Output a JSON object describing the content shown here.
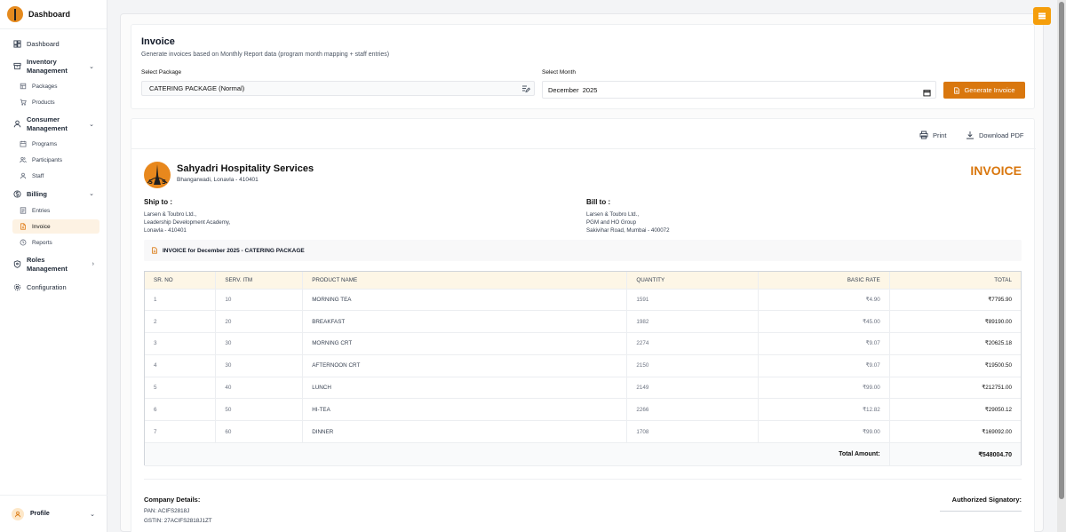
{
  "app": {
    "title": "Dashboard"
  },
  "sidebar": {
    "dashboard": "Dashboard",
    "inventory": {
      "label": "Inventory Management",
      "items": [
        "Packages",
        "Products"
      ]
    },
    "consumer": {
      "label": "Consumer Management",
      "items": [
        "Programs",
        "Participants",
        "Staff"
      ]
    },
    "billing": {
      "label": "Billing",
      "items": [
        "Entries",
        "Invoice",
        "Reports"
      ]
    },
    "roles": "Roles Management",
    "configuration": "Configuration",
    "profile": "Profile"
  },
  "page": {
    "title": "Invoice",
    "subtitle": "Generate invoices based on Monthly Report data (program month mapping + staff entries)",
    "package_label": "Select Package",
    "package_value": "CATERING PACKAGE (Normal)",
    "month_label": "Select Month",
    "month_value": "December  2025",
    "generate_label": "Generate Invoice"
  },
  "toolbar": {
    "print": "Print",
    "download": "Download PDF"
  },
  "invoice": {
    "company_name": "Sahyadri Hospitality Services",
    "company_address": "Bhangarwadi, Lonavla - 410401",
    "heading": "INVOICE",
    "ship_to": {
      "title": "Ship to :",
      "lines": [
        "Larsen & Toubro Ltd.,",
        "Leadership Development Academy,",
        "Lonavla - 410401"
      ]
    },
    "bill_to": {
      "title": "Bill to :",
      "lines": [
        "Larsen & Toubro Ltd.,",
        "PGM and HO Group",
        "Sakivihar Road, Mumbai - 400072"
      ]
    },
    "strip": "INVOICE for December 2025 - CATERING PACKAGE",
    "columns": [
      "SR. NO",
      "SERV. ITM",
      "PRODUCT NAME",
      "QUANTITY",
      "BASIC RATE",
      "TOTAL"
    ],
    "rows": [
      [
        "1",
        "10",
        "MORNING TEA",
        "1591",
        "₹4.90",
        "₹7795.90"
      ],
      [
        "2",
        "20",
        "BREAKFAST",
        "1982",
        "₹45.00",
        "₹89190.00"
      ],
      [
        "3",
        "30",
        "MORNING CRT",
        "2274",
        "₹9.07",
        "₹20625.18"
      ],
      [
        "4",
        "30",
        "AFTERNOON CRT",
        "2150",
        "₹9.07",
        "₹19500.50"
      ],
      [
        "5",
        "40",
        "LUNCH",
        "2149",
        "₹99.00",
        "₹212751.00"
      ],
      [
        "6",
        "50",
        "HI-TEA",
        "2266",
        "₹12.82",
        "₹29050.12"
      ],
      [
        "7",
        "60",
        "DINNER",
        "1708",
        "₹99.00",
        "₹169092.00"
      ]
    ],
    "total_label": "Total Amount:",
    "total_value": "₹548004.70",
    "company_details": {
      "title": "Company Details:",
      "pan": "PAN: ACIFS2818J",
      "gstin": "GSTIN: 27ACIFS2818J1ZT"
    },
    "signatory": "Authorized Signatory:"
  },
  "colors": {
    "accent": "#d9770e",
    "menu_button": "#f59e0b"
  }
}
